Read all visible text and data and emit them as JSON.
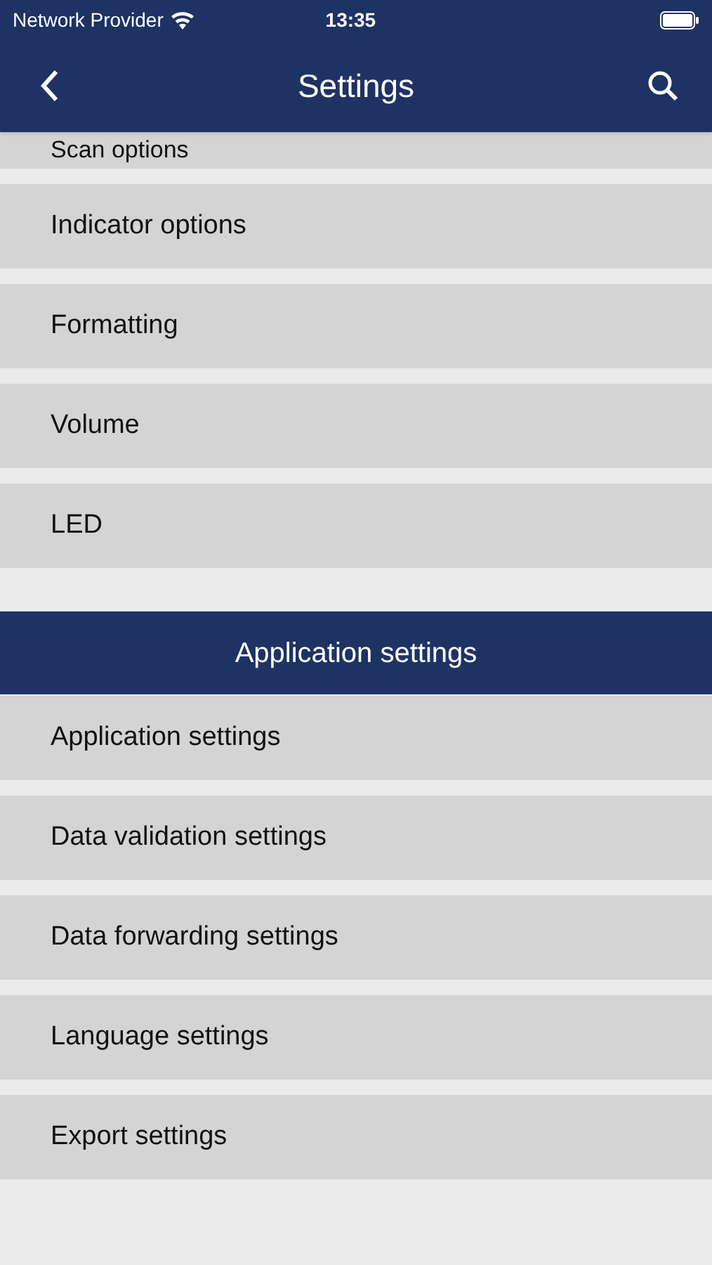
{
  "status_bar": {
    "carrier": "Network Provider",
    "time": "13:35"
  },
  "header": {
    "title": "Settings"
  },
  "partial_item": "Scan options",
  "groups": [
    {
      "items": [
        {
          "label": "Indicator options"
        },
        {
          "label": "Formatting"
        },
        {
          "label": "Volume"
        },
        {
          "label": "LED"
        }
      ]
    },
    {
      "header": "Application settings",
      "items": [
        {
          "label": "Application settings"
        },
        {
          "label": "Data validation settings"
        },
        {
          "label": "Data forwarding settings"
        },
        {
          "label": "Language settings"
        },
        {
          "label": "Export settings"
        }
      ]
    }
  ]
}
